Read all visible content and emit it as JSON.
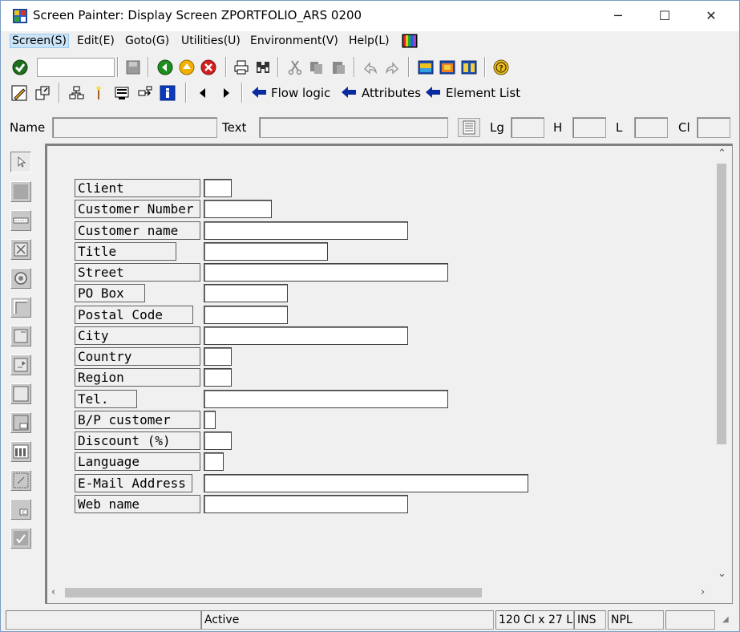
{
  "window": {
    "title": "Screen Painter:  Display Screen ZPORTFOLIO_ARS 0200",
    "controls": {
      "minimize": "─",
      "maximize": "☐",
      "close": "✕"
    }
  },
  "menu": [
    "Screen(S)",
    "Edit(E)",
    "Goto(G)",
    "Utilities(U)",
    "Environment(V)",
    "Help(L)"
  ],
  "toolbar2": {
    "flow_logic": "Flow logic",
    "attributes": "Attributes",
    "element_list": "Element List"
  },
  "attrbar": {
    "name_label": "Name",
    "text_label": "Text",
    "lg_label": "Lg",
    "h_label": "H",
    "l_label": "L",
    "cl_label": "Cl",
    "name_value": "",
    "text_value": "",
    "lg_value": "",
    "h_value": "",
    "l_value": "",
    "cl_value": ""
  },
  "palette": [
    "pointer",
    "text-field",
    "input-output-field",
    "checkbox",
    "radio-button",
    "box",
    "subscreen",
    "table-control",
    "tabstrip",
    "custom-control",
    "step-loop",
    "table-wizard",
    "status-icon",
    "ok-code"
  ],
  "fields": [
    {
      "label": "Client"
    },
    {
      "label": "Customer Number"
    },
    {
      "label": "Customer name"
    },
    {
      "label": "Title"
    },
    {
      "label": "Street"
    },
    {
      "label": "PO Box"
    },
    {
      "label": "Postal Code"
    },
    {
      "label": "City"
    },
    {
      "label": "Country"
    },
    {
      "label": "Region"
    },
    {
      "label": "Tel."
    },
    {
      "label": "B/P customer"
    },
    {
      "label": "Discount (%)"
    },
    {
      "label": "Language"
    },
    {
      "label": "E-Mail Address"
    },
    {
      "label": "Web name"
    }
  ],
  "status": {
    "message": "",
    "mode": "Active",
    "size": "120 Cl x 27 L",
    "ins": "INS",
    "npl": "NPL",
    "extra": ""
  },
  "colors": {
    "accent_blue": "#0000c0",
    "green": "#00a000",
    "yellow": "#e0b000",
    "red": "#d00000"
  }
}
